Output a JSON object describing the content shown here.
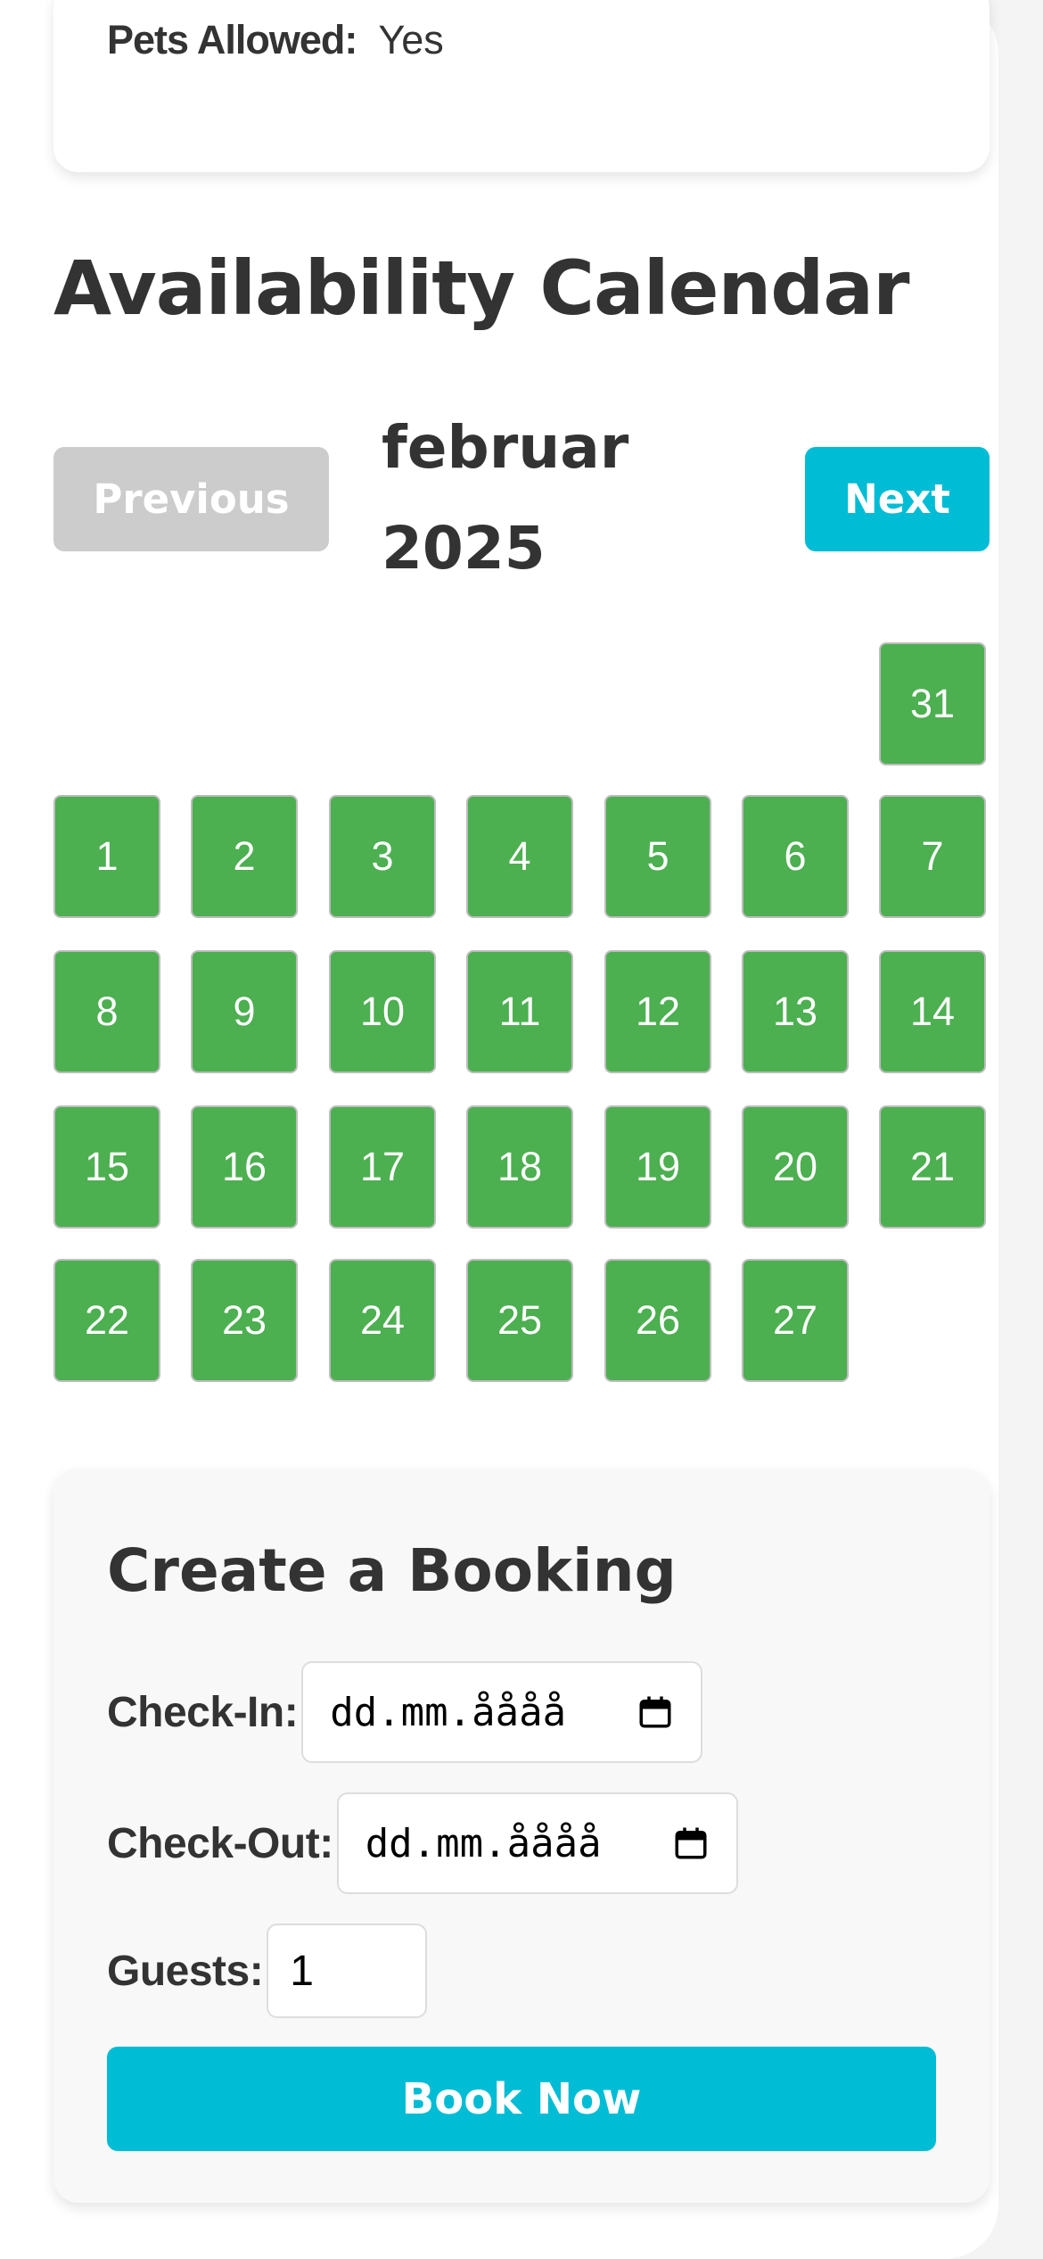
{
  "property_details": {
    "pets_allowed_label": "Pets Allowed:",
    "pets_allowed_value": "Yes"
  },
  "availability": {
    "title": "Availability Calendar",
    "prev_label": "Previous",
    "next_label": "Next",
    "month_name": "februar",
    "year": "2025",
    "days": [
      "31",
      "1",
      "2",
      "3",
      "4",
      "5",
      "6",
      "7",
      "8",
      "9",
      "10",
      "11",
      "12",
      "13",
      "14",
      "15",
      "16",
      "17",
      "18",
      "19",
      "20",
      "21",
      "22",
      "23",
      "24",
      "25",
      "26",
      "27"
    ],
    "available_color": "#4caf50",
    "prev_button_color": "#cccccc",
    "next_button_color": "#00bcd4"
  },
  "booking": {
    "title": "Create a Booking",
    "checkin_label": "Check-In:",
    "checkin_placeholder": "dd.mm.åååå",
    "checkout_label": "Check-Out:",
    "checkout_placeholder": "dd.mm.åååå",
    "guests_label": "Guests:",
    "guests_value": "1",
    "submit_label": "Book Now",
    "submit_color": "#00bcd4",
    "date_icon": "calendar-icon"
  }
}
